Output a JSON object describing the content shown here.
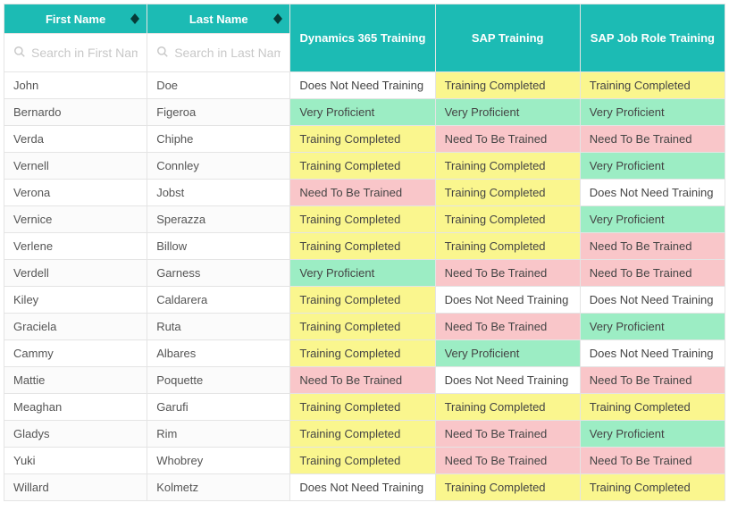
{
  "columns": {
    "first_name": "First Name",
    "last_name": "Last Name",
    "dynamics": "Dynamics 365 Training",
    "sap": "SAP Training",
    "sap_role": "SAP Job Role Training"
  },
  "search": {
    "first_placeholder": "Search in First Name",
    "last_placeholder": "Search in Last Name"
  },
  "status_labels": {
    "vp": "Very Proficient",
    "tc": "Training Completed",
    "nt": "Need To Be Trained",
    "dn": "Does Not Need Training"
  },
  "status_colors": {
    "vp": "#9cedc4",
    "tc": "#faf68e",
    "nt": "#f9c6c9",
    "dn": "#ffffff"
  },
  "rows": [
    {
      "first": "John",
      "last": "Doe",
      "dynamics": "dn",
      "sap": "tc",
      "sap_role": "tc"
    },
    {
      "first": "Bernardo",
      "last": "Figeroa",
      "dynamics": "vp",
      "sap": "vp",
      "sap_role": "vp"
    },
    {
      "first": "Verda",
      "last": "Chiphe",
      "dynamics": "tc",
      "sap": "nt",
      "sap_role": "nt"
    },
    {
      "first": "Vernell",
      "last": "Connley",
      "dynamics": "tc",
      "sap": "tc",
      "sap_role": "vp"
    },
    {
      "first": "Verona",
      "last": "Jobst",
      "dynamics": "nt",
      "sap": "tc",
      "sap_role": "dn"
    },
    {
      "first": "Vernice",
      "last": "Sperazza",
      "dynamics": "tc",
      "sap": "tc",
      "sap_role": "vp"
    },
    {
      "first": "Verlene",
      "last": "Billow",
      "dynamics": "tc",
      "sap": "tc",
      "sap_role": "nt"
    },
    {
      "first": "Verdell",
      "last": "Garness",
      "dynamics": "vp",
      "sap": "nt",
      "sap_role": "nt"
    },
    {
      "first": "Kiley",
      "last": "Caldarera",
      "dynamics": "tc",
      "sap": "dn",
      "sap_role": "dn"
    },
    {
      "first": "Graciela",
      "last": "Ruta",
      "dynamics": "tc",
      "sap": "nt",
      "sap_role": "vp"
    },
    {
      "first": "Cammy",
      "last": "Albares",
      "dynamics": "tc",
      "sap": "vp",
      "sap_role": "dn"
    },
    {
      "first": "Mattie",
      "last": "Poquette",
      "dynamics": "nt",
      "sap": "dn",
      "sap_role": "nt"
    },
    {
      "first": "Meaghan",
      "last": "Garufi",
      "dynamics": "tc",
      "sap": "tc",
      "sap_role": "tc"
    },
    {
      "first": "Gladys",
      "last": "Rim",
      "dynamics": "tc",
      "sap": "nt",
      "sap_role": "vp"
    },
    {
      "first": "Yuki",
      "last": "Whobrey",
      "dynamics": "tc",
      "sap": "nt",
      "sap_role": "nt"
    },
    {
      "first": "Willard",
      "last": "Kolmetz",
      "dynamics": "dn",
      "sap": "tc",
      "sap_role": "tc"
    }
  ]
}
